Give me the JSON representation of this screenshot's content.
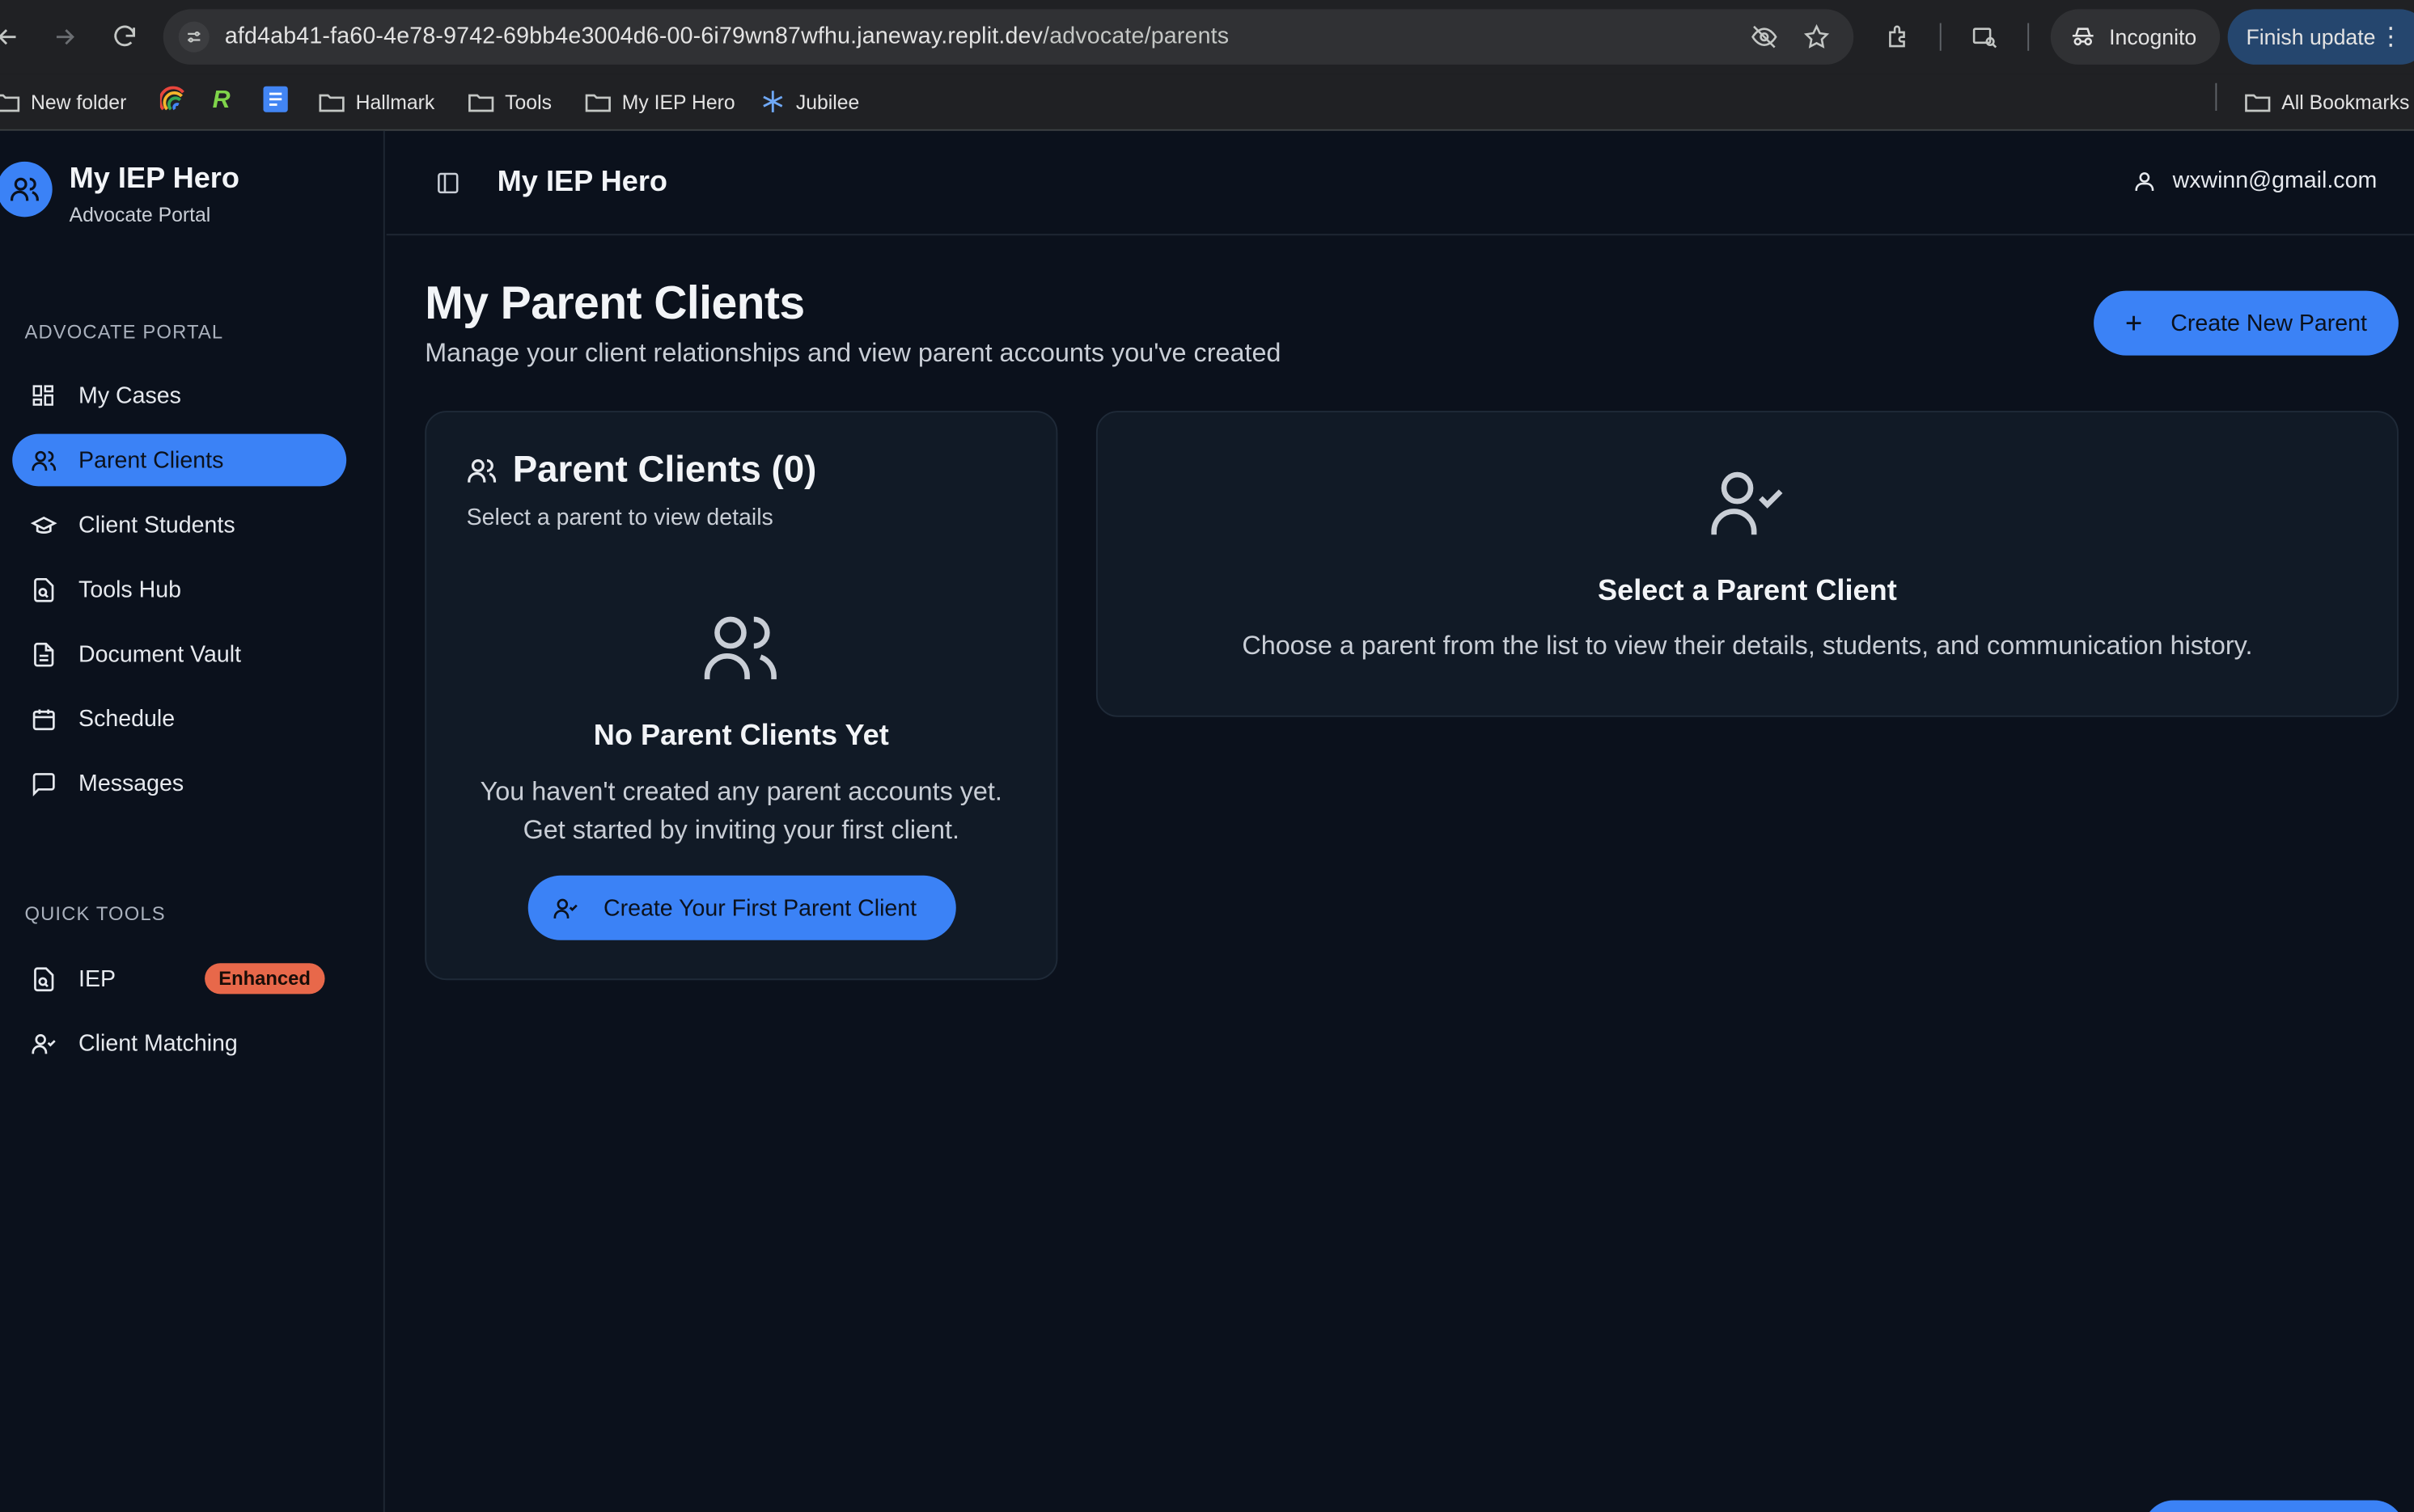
{
  "browser": {
    "url_main": "afd4ab41-fa60-4e78-9742-69bb4e3004d6-00-6i79wn87wfhu.janeway.replit.dev",
    "url_path": "/advocate/parents",
    "incognito_label": "Incognito",
    "finish_update_label": "Finish update",
    "bookmarks": [
      {
        "label": "New folder",
        "icon": "folder-icon"
      },
      {
        "label": "",
        "icon": "rainbow-favicon"
      },
      {
        "label": "",
        "icon": "r-favicon"
      },
      {
        "label": "",
        "icon": "docs-favicon"
      },
      {
        "label": "Hallmark",
        "icon": "folder-icon"
      },
      {
        "label": "Tools",
        "icon": "folder-icon"
      },
      {
        "label": "My IEP Hero",
        "icon": "folder-icon"
      },
      {
        "label": "Jubilee",
        "icon": "jubilee-favicon"
      }
    ],
    "all_bookmarks_label": "All Bookmarks"
  },
  "sidebar": {
    "brand_title": "My IEP Hero",
    "brand_subtitle": "Advocate Portal",
    "section_portal": "ADVOCATE PORTAL",
    "items": [
      {
        "label": "My Cases",
        "icon": "grid-icon",
        "active": false
      },
      {
        "label": "Parent Clients",
        "icon": "users-icon",
        "active": true
      },
      {
        "label": "Client Students",
        "icon": "graduation-cap-icon",
        "active": false
      },
      {
        "label": "Tools Hub",
        "icon": "file-search-icon",
        "active": false
      },
      {
        "label": "Document Vault",
        "icon": "document-icon",
        "active": false
      },
      {
        "label": "Schedule",
        "icon": "calendar-icon",
        "active": false
      },
      {
        "label": "Messages",
        "icon": "message-icon",
        "active": false
      }
    ],
    "section_quick_tools": "QUICK TOOLS",
    "quick_tools": [
      {
        "label": "IEP",
        "icon": "file-search-icon",
        "badge": "Enhanced"
      },
      {
        "label": "Client Matching",
        "icon": "user-check-icon"
      }
    ]
  },
  "topbar": {
    "title": "My IEP Hero",
    "user_email": "wxwinn@gmail.com"
  },
  "main": {
    "title": "My Parent Clients",
    "subtitle": "Manage your client relationships and view parent accounts you've created",
    "create_button": "Create New Parent",
    "list_card": {
      "title": "Parent Clients (0)",
      "subtitle": "Select a parent to view details",
      "empty_title": "No Parent Clients Yet",
      "empty_line1": "You haven't created any parent accounts yet.",
      "empty_line2": "Get started by inviting your first client.",
      "empty_button": "Create Your First Parent Client"
    },
    "detail_card": {
      "title": "Select a Parent Client",
      "text": "Choose a parent from the list to view their details, students, and communication history."
    }
  },
  "colors": {
    "accent": "#3b82f6",
    "background": "#0b111c",
    "card": "#111a26",
    "badge": "#e8684a"
  }
}
